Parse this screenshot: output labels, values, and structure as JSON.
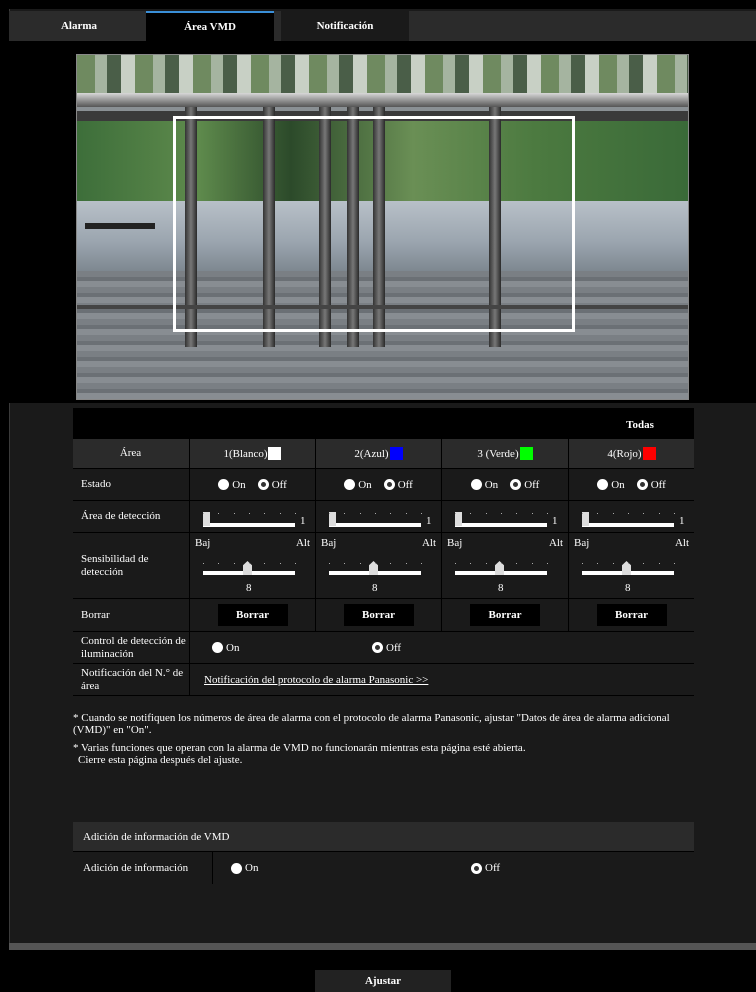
{
  "tabs": [
    {
      "label": "Alarma",
      "active": false
    },
    {
      "label": "Área VMD",
      "active": true
    },
    {
      "label": "Notificación",
      "active": false
    }
  ],
  "all_button": "Todas",
  "table": {
    "area_label": "Área",
    "areas": [
      {
        "label": "1(Blanco)",
        "color": "#ffffff"
      },
      {
        "label": "2(Azul)",
        "color": "#0000ff"
      },
      {
        "label": "3 (Verde)",
        "color": "#00ff00"
      },
      {
        "label": "4(Rojo)",
        "color": "#ff0000"
      }
    ],
    "estado_label": "Estado",
    "on_label": "On",
    "off_label": "Off",
    "estado_values": [
      "Off",
      "Off",
      "Off",
      "Off"
    ],
    "deteccion_label": "Área de detección",
    "deteccion_values": [
      "1",
      "1",
      "1",
      "1"
    ],
    "sensibilidad_label": "Sensibilidad de detección",
    "low_label": "Baj",
    "high_label": "Alt",
    "sensibilidad_values": [
      "8",
      "8",
      "8",
      "8"
    ],
    "sensibilidad_levels": [
      8,
      8,
      8,
      8
    ],
    "sensibilidad_max": 15,
    "borrar_label": "Borrar",
    "borrar_button": "Borrar",
    "iluminacion_label": "Control de detección de iluminación",
    "iluminacion_value": "Off",
    "notif_label": "Notificación del N.° de área",
    "notif_link": "Notificación del protocolo de alarma Panasonic >>"
  },
  "notes": [
    "* Cuando se notifiquen los números de área de alarma con el protocolo de alarma Panasonic, ajustar \"Datos de área de alarma adicional (VMD)\" en \"On\".",
    "* Varias funciones que operan con la alarma de VMD no funcionarán mientras esta página esté abierta.",
    "Cierre esta página después del ajuste."
  ],
  "vmd": {
    "header": "Adición de información de VMD",
    "info_label": "Adición de información",
    "value": "Off"
  },
  "apply_button": "Ajustar"
}
